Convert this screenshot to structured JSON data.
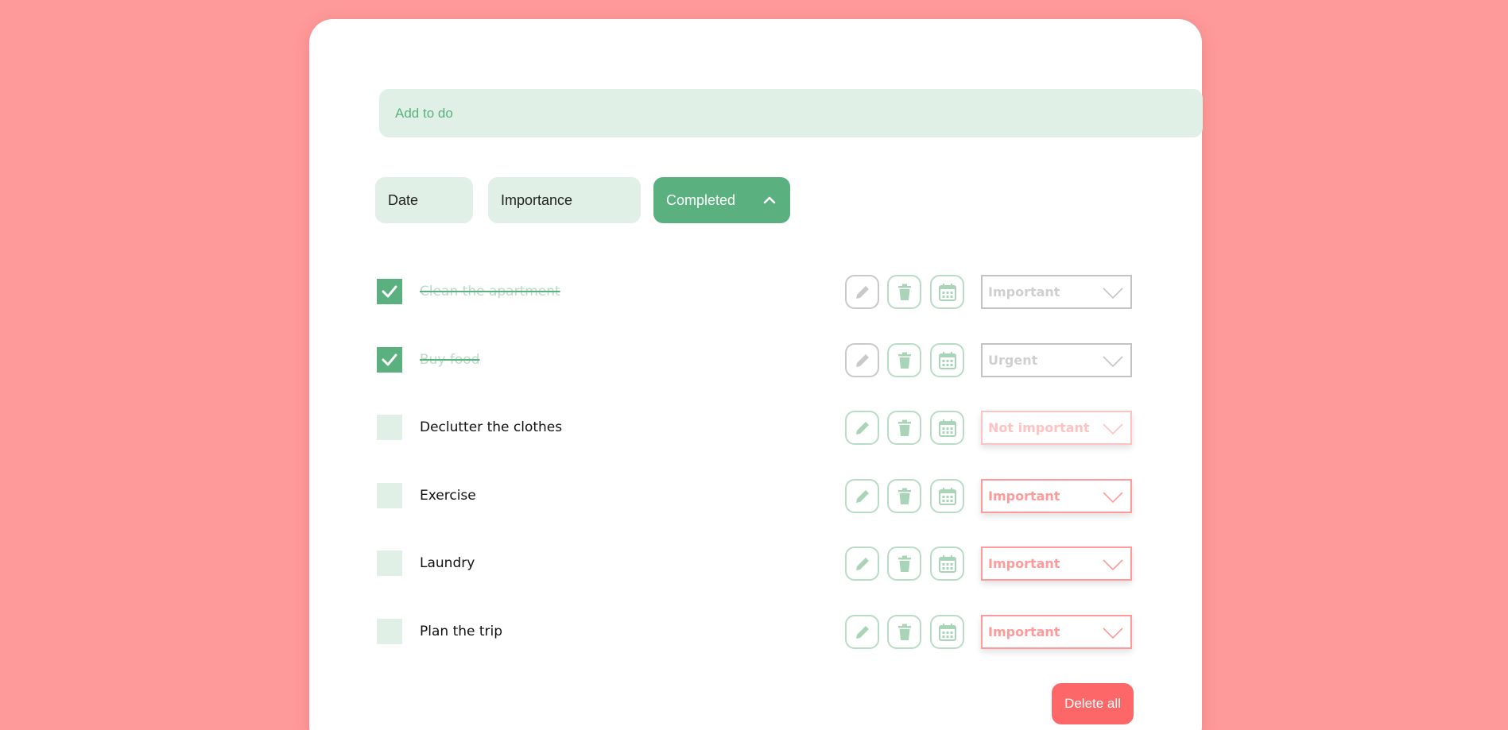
{
  "add_todo": {
    "placeholder": "Add to do"
  },
  "filters": [
    {
      "label": "Date",
      "active": false
    },
    {
      "label": "Importance",
      "active": false
    },
    {
      "label": "Completed",
      "active": true
    }
  ],
  "todos": [
    {
      "text": "Clean the apartment",
      "completed": true,
      "importance": "Important"
    },
    {
      "text": "Buy food",
      "completed": true,
      "importance": "Urgent"
    },
    {
      "text": "Declutter the clothes",
      "completed": false,
      "importance": "Not important"
    },
    {
      "text": "Exercise",
      "completed": false,
      "importance": "Important"
    },
    {
      "text": "Laundry",
      "completed": false,
      "importance": "Important"
    },
    {
      "text": "Plan the trip",
      "completed": false,
      "importance": "Important"
    }
  ],
  "delete_all_label": "Delete all",
  "colors": {
    "background": "#ff9a9a",
    "accent_green": "#5ab07e",
    "light_green": "#e1f0e6",
    "delete_red": "#fe6767"
  },
  "icons": [
    "pencil-icon",
    "trash-icon",
    "calendar-icon",
    "chevron-down-icon",
    "chevron-up-icon",
    "check-icon"
  ]
}
